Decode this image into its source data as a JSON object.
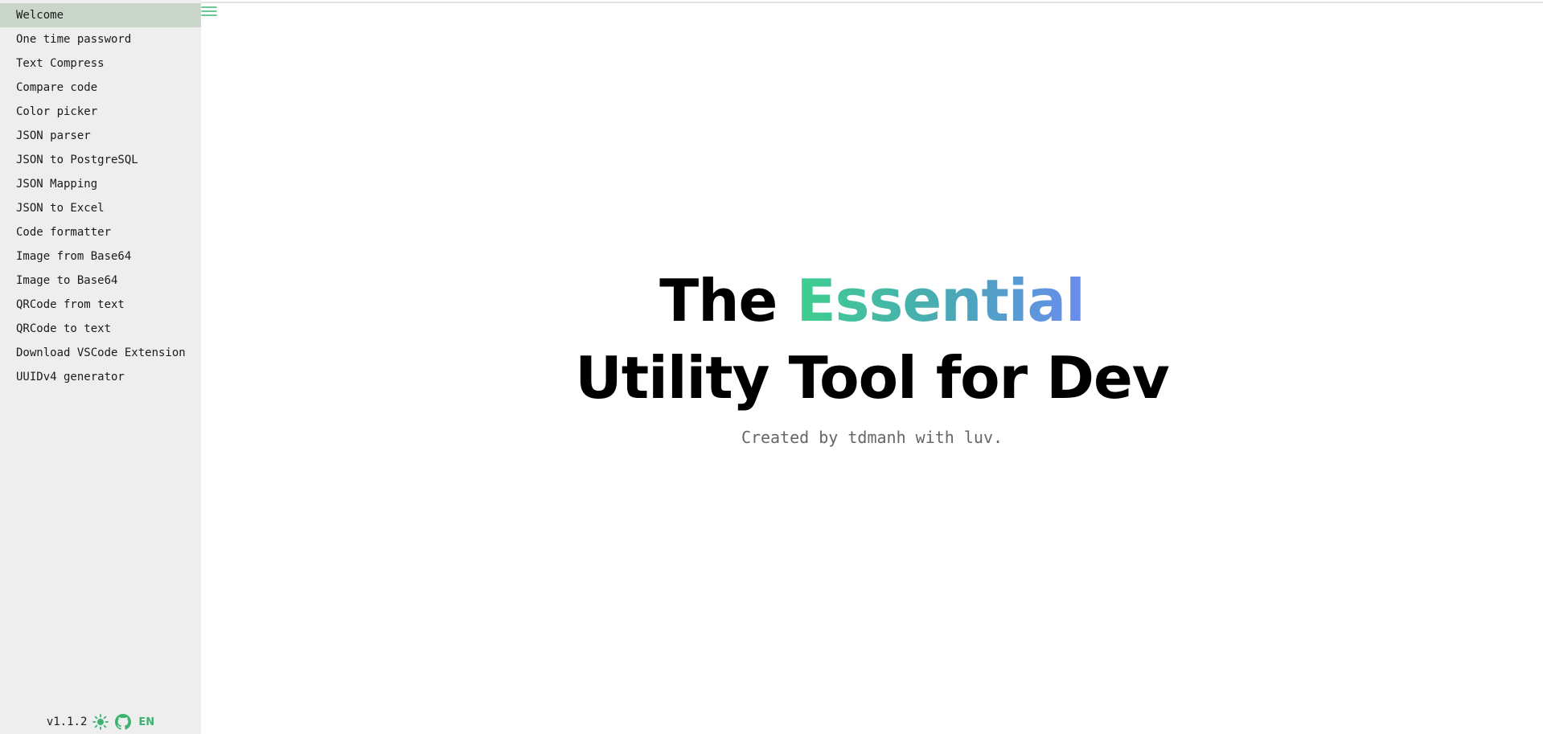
{
  "sidebar": {
    "items": [
      {
        "label": "Welcome",
        "active": true
      },
      {
        "label": "One time password"
      },
      {
        "label": "Text Compress"
      },
      {
        "label": "Compare code"
      },
      {
        "label": "Color picker"
      },
      {
        "label": "JSON parser"
      },
      {
        "label": "JSON to PostgreSQL"
      },
      {
        "label": "JSON Mapping"
      },
      {
        "label": "JSON to Excel"
      },
      {
        "label": "Code formatter"
      },
      {
        "label": "Image from Base64"
      },
      {
        "label": "Image to Base64"
      },
      {
        "label": "QRCode from text"
      },
      {
        "label": "QRCode to text"
      },
      {
        "label": "Download VSCode Extension"
      },
      {
        "label": "UUIDv4 generator"
      }
    ],
    "footer": {
      "version": "v1.1.2",
      "theme_icon": "sun-icon",
      "repo_icon": "github-icon",
      "language": "EN"
    }
  },
  "header": {
    "menu_icon": "hamburger-menu-icon"
  },
  "hero": {
    "line1_prefix": "The",
    "line1_highlight": "Essential",
    "line2": "Utility Tool for Dev",
    "subtitle": "Created by tdmanh with luv."
  },
  "colors": {
    "accent": "#3cb371",
    "active_item_bg": "#c9d6c9",
    "sidebar_bg": "#eeeeee",
    "gradient_start": "#3ecf8e",
    "gradient_end": "#6a8cf0"
  }
}
